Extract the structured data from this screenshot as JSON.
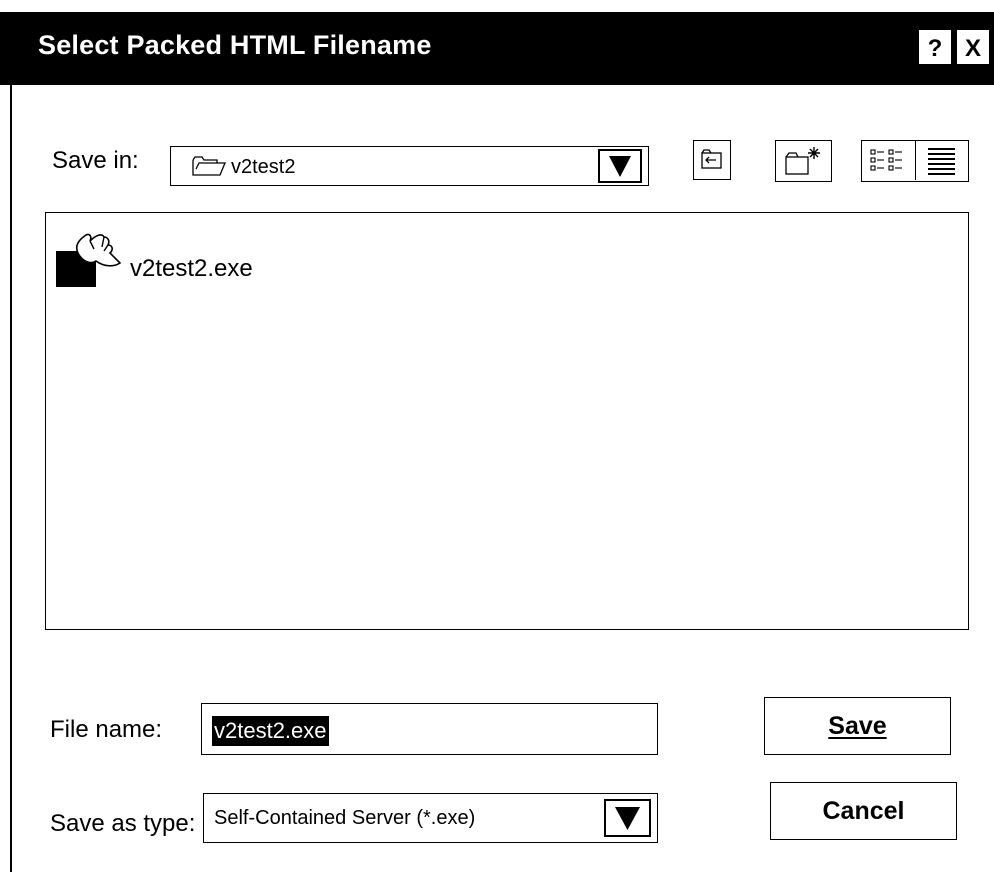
{
  "window": {
    "title": "Select Packed HTML Filename",
    "help_label": "?",
    "close_label": "X"
  },
  "save_in": {
    "label": "Save in:",
    "value": "v2test2"
  },
  "toolbar": {
    "icons": [
      "up-one-level-icon",
      "create-new-folder-icon",
      "list-view-icon",
      "details-view-icon"
    ]
  },
  "file_list": {
    "items": [
      {
        "name": "v2test2.exe",
        "icon": "executable-file-icon"
      }
    ]
  },
  "file_name": {
    "label": "File name:",
    "value": "v2test2.exe"
  },
  "save_as_type": {
    "label": "Save as type:",
    "value": "Self-Contained Server (*.exe)"
  },
  "buttons": {
    "save_label": "Save",
    "cancel_label": "Cancel"
  }
}
